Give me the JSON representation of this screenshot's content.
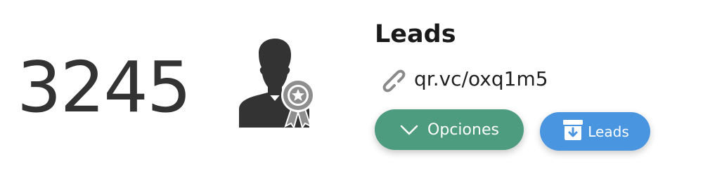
{
  "stat": {
    "count": "3245"
  },
  "header": {
    "title": "Leads"
  },
  "link": {
    "url_text": "qr.vc/oxq1m5"
  },
  "actions": {
    "options_label": "Opciones",
    "leads_label": "Leads"
  },
  "icons": {
    "badge": "user-award-icon",
    "link": "link-chain-icon",
    "options": "chevron-down-icon",
    "leads": "archive-download-icon"
  },
  "colors": {
    "options_button": "#4e9c80",
    "leads_button": "#4a95e0",
    "icon_gray": "#333333",
    "link_icon": "#8a8a8a"
  }
}
